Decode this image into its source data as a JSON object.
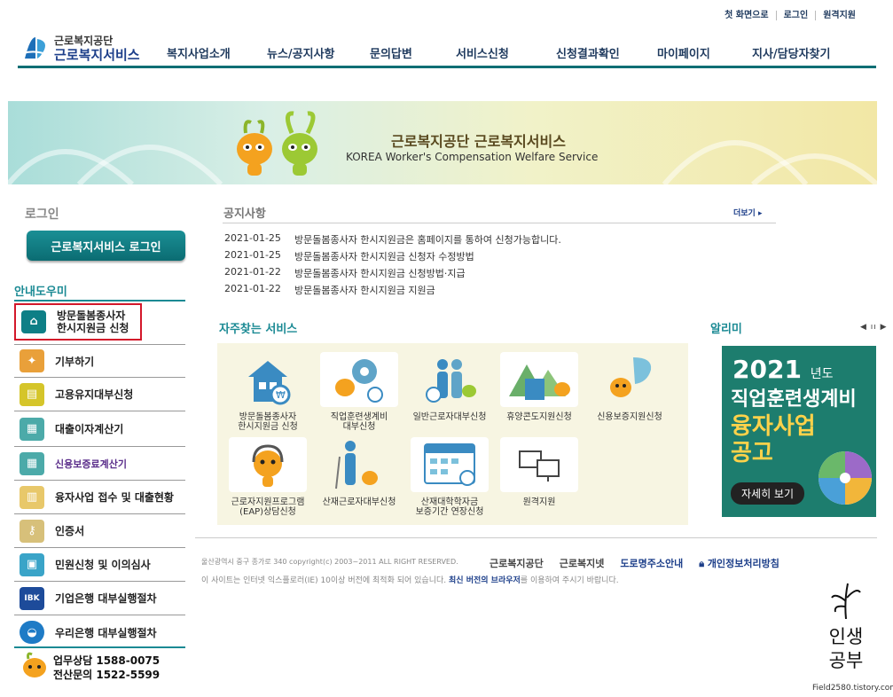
{
  "header": {
    "util": [
      "첫 화면으로",
      "로그인",
      "원격지원"
    ],
    "logo": {
      "line1": "근로복지공단",
      "line2": "근로복지서비스"
    },
    "nav": [
      "복지사업소개",
      "뉴스/공지사항",
      "문의답변",
      "서비스신청",
      "신청결과확인",
      "마이페이지",
      "지사/담당자찾기"
    ]
  },
  "banner": {
    "title": "근로복지공단 근로복지서비스",
    "subtitle": "KOREA Worker's Compensation Welfare Service"
  },
  "login": {
    "title": "로그인",
    "button": "근로복지서비스 로그인"
  },
  "guide": {
    "title": "안내도우미",
    "items": [
      {
        "label1": "방문돌봄종사자",
        "label2": "한시지원금 신청",
        "color": "#0e7f86"
      },
      {
        "label": "기부하기",
        "color": "#e9a03a"
      },
      {
        "label": "고용유지대부신청",
        "color": "#d5c52a"
      },
      {
        "label": "대출이자계산기",
        "color": "#4caaa9"
      },
      {
        "label": "신용보증료계산기",
        "color": "#4caaa9"
      },
      {
        "label": "융자사업 접수 및 대출현황",
        "color": "#e8c86a"
      },
      {
        "label": "인증서",
        "color": "#d7c07a"
      },
      {
        "label": "민원신청 및 이의심사",
        "color": "#3aa4c8"
      },
      {
        "label": "기업은행 대부실행절차",
        "color": "#1d4b9a"
      },
      {
        "label": "우리은행 대부실행절차",
        "color": "#1e7bc6"
      }
    ],
    "contact": {
      "line1": "업무상담 1588-0075",
      "line2": "전산문의 1522-5599"
    }
  },
  "notice": {
    "title": "공지사항",
    "more": "더보기",
    "items": [
      {
        "date": "2021-01-25",
        "title": "방문돌봄종사자 한시지원금은 홈페이지를 통하여 신청가능합니다."
      },
      {
        "date": "2021-01-25",
        "title": "방문돌봄종사자 한시지원금 신청자 수정방법"
      },
      {
        "date": "2021-01-22",
        "title": "방문돌봄종사자 한시지원금 신청방법·지급"
      },
      {
        "date": "2021-01-22",
        "title": "방문돌봄종사자 한시지원금 지원금"
      }
    ]
  },
  "services": {
    "title": "자주찾는 서비스",
    "items": [
      {
        "l1": "방문돌봄종사자",
        "l2": "한시지원금 신청"
      },
      {
        "l1": "직업훈련생계비",
        "l2": "대부신청"
      },
      {
        "l1": "일반근로자대부신청",
        "l2": ""
      },
      {
        "l1": "휴양콘도지원신청",
        "l2": ""
      },
      {
        "l1": "신용보증지원신청",
        "l2": ""
      },
      {
        "l1": "근로자지원프로그램",
        "l2": "(EAP)상담신청"
      },
      {
        "l1": "산재근로자대부신청",
        "l2": ""
      },
      {
        "l1": "산재대학학자금",
        "l2": "보증기간 연장신청"
      },
      {
        "l1": "원격지원",
        "l2": ""
      }
    ]
  },
  "alimi": {
    "title": "알리미",
    "controls": "◀ ıı ▶",
    "year": "2021",
    "year_suffix": "년도",
    "line1": "직업훈련생계비",
    "line2": "융자사업",
    "line3": "공고",
    "button": "자세히 보기"
  },
  "footer": {
    "address": "울산광역시 중구 종가로 340  copyright(c) 2003~2011 ALL RIGHT RESERVED.",
    "note_pre": "이 사이트는 인터넷 익스플로러(IE) 10이상 버전에 최적화 되어 있습니다.",
    "note_bold": "최신 버전의 브라우저",
    "note_post": "를 이용하여 주시기 바랍니다.",
    "links": [
      "근로복지공단",
      "근로복지넷",
      "도로명주소안내",
      "개인정보처리방침"
    ]
  },
  "watermark": {
    "l1": "인생",
    "l2": "공부",
    "url": "Field2580.tistory.com"
  }
}
